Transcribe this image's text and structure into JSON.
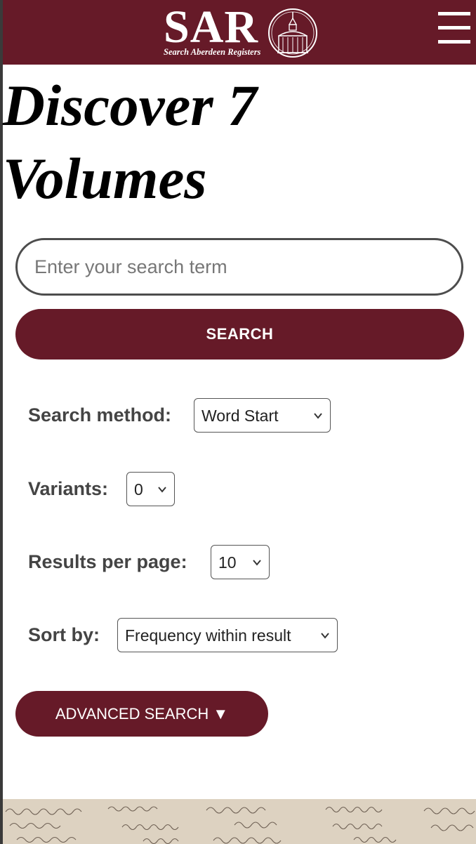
{
  "header": {
    "logo_text": "SAR",
    "logo_subtitle": "Search Aberdeen Registers",
    "bg_color": "#661a28"
  },
  "page": {
    "title": "Discover 7 Volumes"
  },
  "search": {
    "placeholder": "Enter your search term",
    "value": "",
    "button_label": "SEARCH"
  },
  "options": {
    "method": {
      "label": "Search method:",
      "selected": "Word Start"
    },
    "variants": {
      "label": "Variants:",
      "selected": "0"
    },
    "per_page": {
      "label": "Results per page:",
      "selected": "10"
    },
    "sort": {
      "label": "Sort by:",
      "selected": "Frequency within result"
    }
  },
  "advanced": {
    "label": "ADVANCED SEARCH ▼"
  },
  "icons": {
    "menu": "hamburger-menu-icon",
    "seal": "st-nicholas-kirk-seal-icon",
    "chevron": "chevron-down-icon"
  },
  "colors": {
    "accent": "#661a28",
    "footer_bg": "#ddd2c1"
  }
}
